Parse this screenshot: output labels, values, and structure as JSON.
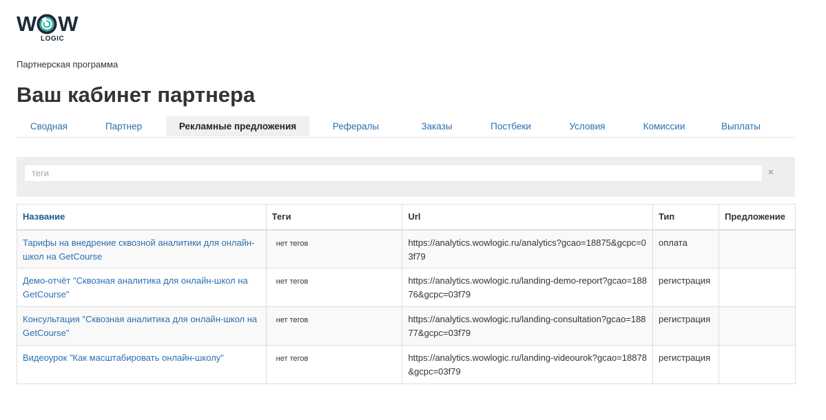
{
  "logo": {
    "main": "WOW",
    "sub": "LOGIC",
    "colors": {
      "dark": "#1d2a3a",
      "teal": "#27b3a4"
    }
  },
  "breadcrumb": "Партнерская программа",
  "page_title": "Ваш кабинет партнера",
  "tabs": [
    {
      "label": "Сводная",
      "active": false
    },
    {
      "label": "Партнер",
      "active": false
    },
    {
      "label": "Рекламные предложения",
      "active": true
    },
    {
      "label": "Рефералы",
      "active": false
    },
    {
      "label": "Заказы",
      "active": false
    },
    {
      "label": "Постбеки",
      "active": false
    },
    {
      "label": "Условия",
      "active": false
    },
    {
      "label": "Комиссии",
      "active": false
    },
    {
      "label": "Выплаты",
      "active": false
    }
  ],
  "filter": {
    "placeholder": "теги",
    "value": "",
    "clear_glyph": "×"
  },
  "table": {
    "columns": [
      "Название",
      "Теги",
      "Url",
      "Тип",
      "Предложение"
    ],
    "rows": [
      {
        "name": "Тарифы на внедрение сквозной аналитики для онлайн-школ на GetCourse",
        "tags": "нет тегов",
        "url": "https://analytics.wowlogic.ru/analytics?gcao=18875&gcpc=03f79",
        "type": "оплата",
        "offer": ""
      },
      {
        "name": "Демо-отчёт \"Сквозная аналитика для онлайн-школ на GetCourse\"",
        "tags": "нет тегов",
        "url": "https://analytics.wowlogic.ru/landing-demo-report?gcao=18876&gcpc=03f79",
        "type": "регистрация",
        "offer": ""
      },
      {
        "name": "Консультация \"Сквозная аналитика для онлайн-школ на GetCourse\"",
        "tags": "нет тегов",
        "url": "https://analytics.wowlogic.ru/landing-consultation?gcao=18877&gcpc=03f79",
        "type": "регистрация",
        "offer": ""
      },
      {
        "name": "Видеоурок \"Как масштабировать онлайн-школу\"",
        "tags": "нет тегов",
        "url": "https://analytics.wowlogic.ru/landing-videourok?gcao=18878&gcpc=03f79",
        "type": "регистрация",
        "offer": ""
      }
    ]
  }
}
